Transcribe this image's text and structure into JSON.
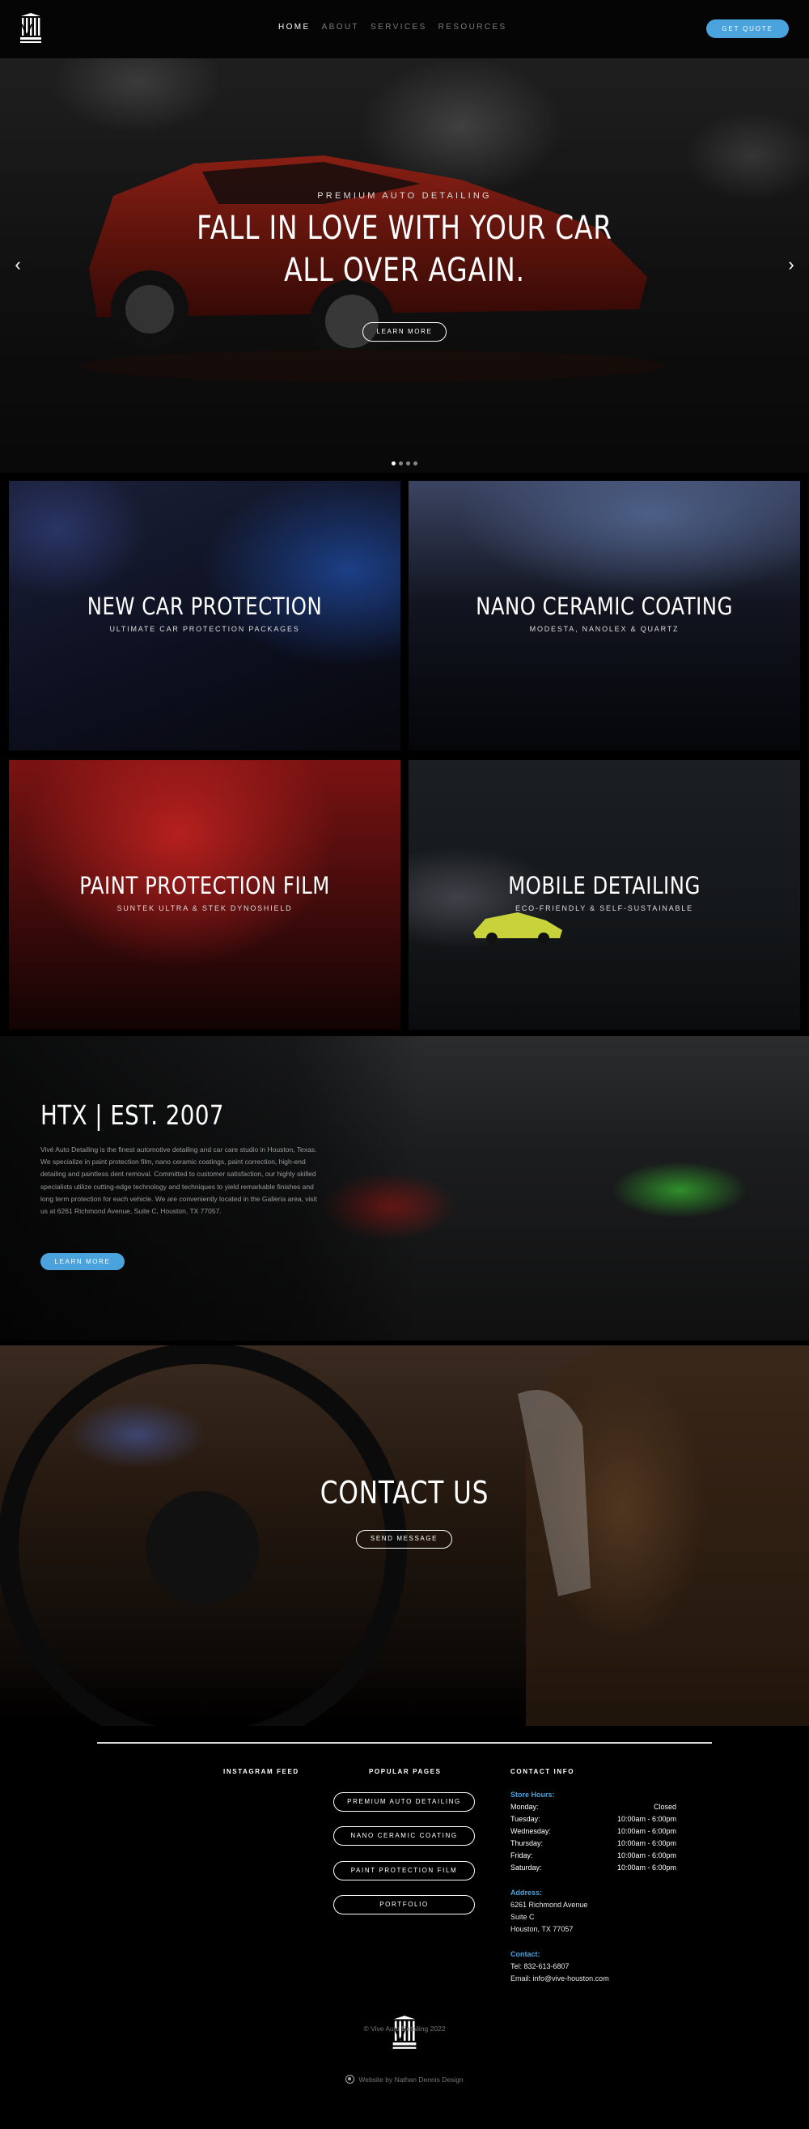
{
  "header": {
    "nav": [
      "HOME",
      "ABOUT",
      "SERVICES",
      "RESOURCES"
    ],
    "cta": "GET QUOTE"
  },
  "hero": {
    "kicker": "PREMIUM AUTO DETAILING",
    "title_line1": "FALL IN LOVE WITH YOUR CAR",
    "title_line2": "ALL OVER AGAIN.",
    "button": "LEARN MORE",
    "prev": "‹",
    "next": "›",
    "slides": 4,
    "active_slide": 1
  },
  "services": [
    {
      "title": "NEW CAR PROTECTION",
      "sub": "ULTIMATE CAR PROTECTION PACKAGES"
    },
    {
      "title": "NANO CERAMIC COATING",
      "sub": "MODESTA, NANOLEX & QUARTZ"
    },
    {
      "title": "PAINT PROTECTION FILM",
      "sub": "SUNTEK ULTRA & STEK DYNOSHIELD"
    },
    {
      "title": "MOBILE DETAILING",
      "sub": "ECO-FRIENDLY & SELF-SUSTAINABLE"
    }
  ],
  "about": {
    "title": "HTX | EST. 2007",
    "text": "Vivé Auto Detailing is the finest automotive detailing and car care studio in Houston, Texas. We specialize in paint protection film, nano ceramic coatings, paint correction, high-end detailing and paintless dent removal. Committed to customer satisfaction, our highly skilled specialists utilize cutting-edge technology and techniques to yield remarkable finishes and long term protection for each vehicle. We are conveniently located in the Galleria area, visit us at 6261 Richmond Avenue, Suite C, Houston, TX 77057.",
    "button": "LEARN MORE"
  },
  "contact": {
    "title": "CONTACT US",
    "button": "SEND MESSAGE"
  },
  "footer": {
    "instagram_heading": "INSTAGRAM FEED",
    "pages_heading": "POPULAR PAGES",
    "info_heading": "CONTACT INFO",
    "pages": [
      "PREMIUM AUTO DETAILING",
      "NANO CERAMIC COATING",
      "PAINT PROTECTION FILM",
      "PORTFOLIO"
    ],
    "hours_label": "Store Hours:",
    "hours": [
      {
        "day": "Monday:",
        "time": "Closed"
      },
      {
        "day": "Tuesday:",
        "time": "10:00am - 6:00pm"
      },
      {
        "day": "Wednesday:",
        "time": "10:00am - 6:00pm"
      },
      {
        "day": "Thursday:",
        "time": "10:00am - 6:00pm"
      },
      {
        "day": "Friday:",
        "time": "10:00am - 6:00pm"
      },
      {
        "day": "Saturday:",
        "time": "10:00am - 6:00pm"
      }
    ],
    "address_label": "Address:",
    "address": [
      "6261 Richmond Avenue",
      "Suite C",
      "Houston, TX 77057"
    ],
    "contact_label": "Contact:",
    "tel": "Tel: 832-613-6807",
    "email": "Email: info@vive-houston.com",
    "copyright": "© Vive Auto Detailing 2022",
    "credit": "Website by Nathan Dennis Design"
  },
  "colors": {
    "accent": "#4aa3dc",
    "background": "#000000"
  }
}
